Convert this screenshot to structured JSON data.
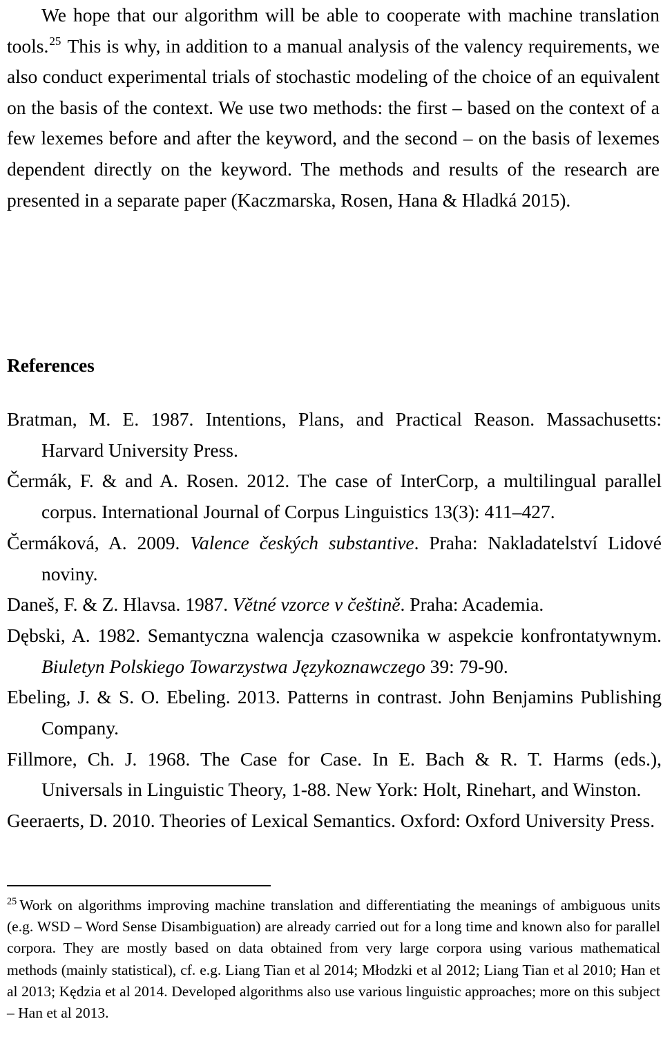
{
  "document": {
    "type": "academic-paper-page",
    "body_paragraph": {
      "text_before_marker": "We hope that our algorithm will be able to cooperate with machine translation tools.",
      "footnote_marker": "25",
      "text_after_marker": " This is why, in addition to a manual analysis of the valency requirements, we also conduct experimental trials of stochastic modeling of the choice of an equivalent on the basis of the context. We use two methods: the first – based on the context of a few lexemes before and after the keyword, and the second – on the basis of lexemes dependent directly on the keyword. The methods and results of the research are presented in a separate paper (Kaczmarska, Rosen, Hana & Hladká 2015)."
    },
    "references_heading": "References",
    "references": [
      {
        "id": "bratman-1987",
        "parts": [
          {
            "text": "Bratman, M. E. 1987. Intentions, Plans, and Practical Reason. Massachusetts: Harvard University Press.",
            "style": "roman"
          }
        ]
      },
      {
        "id": "cermak-rosen-2012",
        "parts": [
          {
            "text": "Čermák, F. & and A. Rosen. 2012. The case of InterCorp, a multilingual parallel corpus. International Journal of Corpus Linguistics 13(3): 411–427.",
            "style": "roman"
          }
        ]
      },
      {
        "id": "cermakova-2009",
        "parts": [
          {
            "text": "Čermáková, A. 2009. ",
            "style": "roman"
          },
          {
            "text": "Valence českých substantive",
            "style": "italic"
          },
          {
            "text": ". Praha: Nakladatelství Lidové noviny.",
            "style": "roman"
          }
        ]
      },
      {
        "id": "danes-hlavsa-1987",
        "parts": [
          {
            "text": "Daneš, F. & Z. Hlavsa. 1987. ",
            "style": "roman"
          },
          {
            "text": "Větné vzorce v češtině",
            "style": "italic"
          },
          {
            "text": ". Praha: Academia.",
            "style": "roman"
          }
        ]
      },
      {
        "id": "debski-1982",
        "parts": [
          {
            "text": "Dębski, A. 1982. Semantyczna walencja czasownika w aspekcie konfrontatywnym. ",
            "style": "roman"
          },
          {
            "text": "Biuletyn Polskiego Towarzystwa Językoznawczego",
            "style": "italic"
          },
          {
            "text": " 39: 79-90.",
            "style": "roman"
          }
        ]
      },
      {
        "id": "ebeling-ebeling-2013",
        "parts": [
          {
            "text": "Ebeling, J. & S. O. Ebeling. 2013. Patterns in contrast. John Benjamins Publishing Company.",
            "style": "roman"
          }
        ]
      },
      {
        "id": "fillmore-1968",
        "parts": [
          {
            "text": "Fillmore, Ch. J. 1968. The Case for Case. In E. Bach & R. T. Harms (eds.), Universals in Linguistic Theory, 1-88. New York: Holt, Rinehart, and Winston.",
            "style": "roman"
          }
        ]
      },
      {
        "id": "geeraerts-2010",
        "parts": [
          {
            "text": "Geeraerts, D. 2010. Theories of Lexical Semantics. Oxford: Oxford University Press.",
            "style": "roman"
          }
        ]
      }
    ],
    "footnote": {
      "number": "25",
      "text": "Work on algorithms improving machine translation and differentiating the meanings of ambiguous units (e.g. WSD – Word Sense Disambiguation) are already carried out for a long time and known also for parallel corpora. They are mostly based on data obtained from very large corpora using various mathematical methods (mainly statistical), cf. e.g. Liang Tian et al 2014; Młodzki et al 2012; Liang Tian et al 2010; Han et al 2013; Kędzia et al 2014. Developed algorithms also use various linguistic approaches; more on this subject – Han et al 2013."
    },
    "colors": {
      "page_background": "#ffffff",
      "text": "#000000",
      "footnote_rule": "#000000"
    }
  }
}
